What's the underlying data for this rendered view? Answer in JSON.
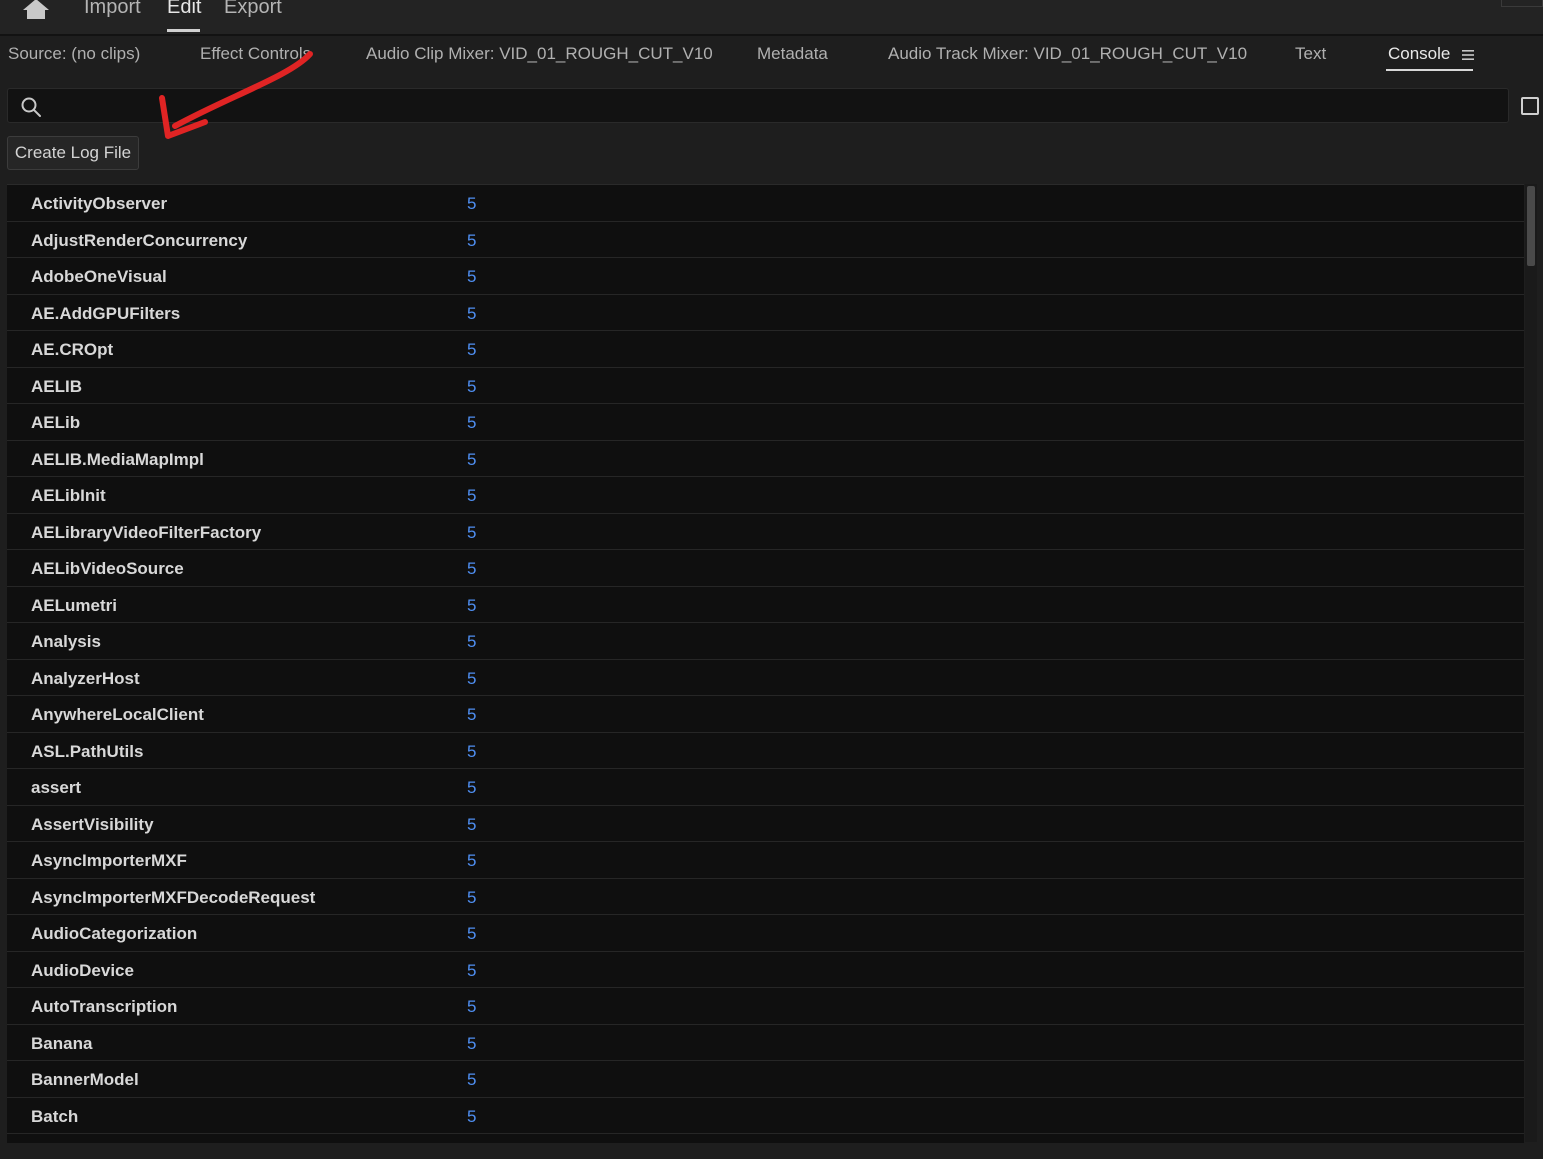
{
  "top_nav": {
    "items": [
      "Import",
      "Edit",
      "Export"
    ],
    "active": "Edit",
    "home_icon": "home-icon"
  },
  "tabs": [
    "Source: (no clips)",
    "Effect Controls",
    "Audio Clip Mixer: VID_01_ROUGH_CUT_V10",
    "Metadata",
    "Audio Track Mixer: VID_01_ROUGH_CUT_V10",
    "Text",
    "Console"
  ],
  "active_tab": "Console",
  "search": {
    "placeholder": "",
    "value": ""
  },
  "create_log_button": "Create Log File",
  "annotation_color": "#e02424",
  "accent_value_color": "#4f8ff2",
  "rows": [
    {
      "name": "ActivityObserver",
      "value": "5"
    },
    {
      "name": "AdjustRenderConcurrency",
      "value": "5"
    },
    {
      "name": "AdobeOneVisual",
      "value": "5"
    },
    {
      "name": "AE.AddGPUFilters",
      "value": "5"
    },
    {
      "name": "AE.CROpt",
      "value": "5"
    },
    {
      "name": "AELIB",
      "value": "5"
    },
    {
      "name": "AELib",
      "value": "5"
    },
    {
      "name": "AELIB.MediaMapImpl",
      "value": "5"
    },
    {
      "name": "AELibInit",
      "value": "5"
    },
    {
      "name": "AELibraryVideoFilterFactory",
      "value": "5"
    },
    {
      "name": "AELibVideoSource",
      "value": "5"
    },
    {
      "name": "AELumetri",
      "value": "5"
    },
    {
      "name": "Analysis",
      "value": "5"
    },
    {
      "name": "AnalyzerHost",
      "value": "5"
    },
    {
      "name": "AnywhereLocalClient",
      "value": "5"
    },
    {
      "name": "ASL.PathUtils",
      "value": "5"
    },
    {
      "name": "assert",
      "value": "5"
    },
    {
      "name": "AssertVisibility",
      "value": "5"
    },
    {
      "name": "AsyncImporterMXF",
      "value": "5"
    },
    {
      "name": "AsyncImporterMXFDecodeRequest",
      "value": "5"
    },
    {
      "name": "AudioCategorization",
      "value": "5"
    },
    {
      "name": "AudioDevice",
      "value": "5"
    },
    {
      "name": "AutoTranscription",
      "value": "5"
    },
    {
      "name": "Banana",
      "value": "5"
    },
    {
      "name": "BannerModel",
      "value": "5"
    },
    {
      "name": "Batch",
      "value": "5"
    }
  ]
}
